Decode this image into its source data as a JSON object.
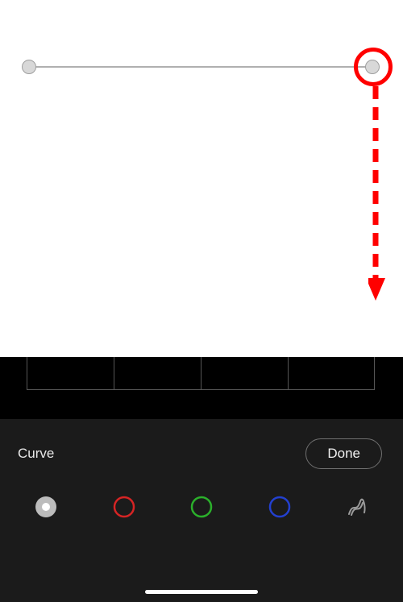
{
  "panel": {
    "title": "Curve",
    "done_label": "Done"
  },
  "channels": {
    "luma_name": "luma-channel",
    "red_name": "red-channel",
    "green_name": "green-channel",
    "blue_name": "blue-channel",
    "parametric_name": "parametric-curve"
  },
  "colors": {
    "red": "#d62424",
    "green": "#2bb02b",
    "blue": "#2340cf",
    "luma_fill": "#bcbcbc",
    "luma_dot": "#ffffff",
    "parametric": "#9c9c9c"
  }
}
